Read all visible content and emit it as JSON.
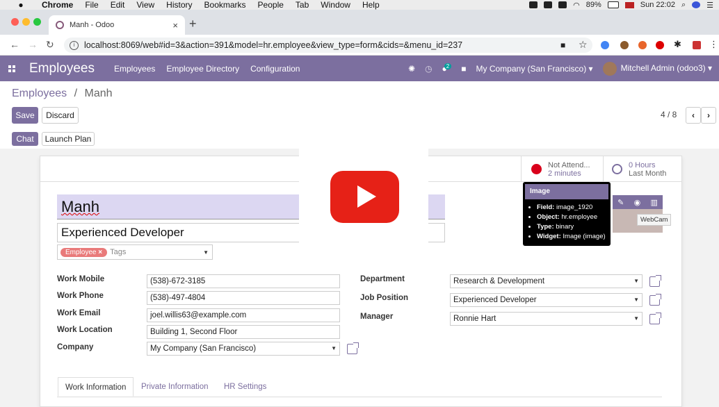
{
  "macbar": {
    "apple": "",
    "app": "Chrome",
    "menus": [
      "File",
      "Edit",
      "View",
      "History",
      "Bookmarks",
      "People",
      "Tab",
      "Window",
      "Help"
    ],
    "battery": "89%",
    "clock": "Sun 22:02"
  },
  "browser": {
    "tab_title": "Manh - Odoo",
    "url": "localhost:8069/web#id=3&action=391&model=hr.employee&view_type=form&cids=&menu_id=237"
  },
  "odoo_nav": {
    "brand": "Employees",
    "menus": [
      "Employees",
      "Employee Directory",
      "Configuration"
    ],
    "chat_badge": "2",
    "company": "My Company (San Francisco)",
    "user": "Mitchell Admin (odoo3)"
  },
  "control": {
    "breadcrumb_root": "Employees",
    "breadcrumb_sep": "/",
    "breadcrumb_current": "Manh",
    "save": "Save",
    "discard": "Discard",
    "pager": "4 / 8",
    "chat": "Chat",
    "launch_plan": "Launch Plan"
  },
  "stats": {
    "attendance_line1": "Not Attend...",
    "attendance_line2": "2 minutes",
    "hours_line1": "0 Hours",
    "hours_line2": "Last Month"
  },
  "employee": {
    "name": "Manh",
    "job_title": "Experienced Developer",
    "tag": "Employee",
    "tags_placeholder": "Tags"
  },
  "left_fields": [
    {
      "label": "Work Mobile",
      "value": "(538)-672-3185"
    },
    {
      "label": "Work Phone",
      "value": "(538)-497-4804"
    },
    {
      "label": "Work Email",
      "value": "joel.willis63@example.com"
    },
    {
      "label": "Work Location",
      "value": "Building 1, Second Floor"
    },
    {
      "label": "Company",
      "value": "My Company (San Francisco)"
    }
  ],
  "right_fields": [
    {
      "label": "Department",
      "value": "Research & Development"
    },
    {
      "label": "Job Position",
      "value": "Experienced Developer"
    },
    {
      "label": "Manager",
      "value": "Ronnie Hart"
    }
  ],
  "tooltip": {
    "title": "Image",
    "items": [
      {
        "k": "Field:",
        "v": "image_1920"
      },
      {
        "k": "Object:",
        "v": "hr.employee"
      },
      {
        "k": "Type:",
        "v": "binary"
      },
      {
        "k": "Widget:",
        "v": "Image (image)"
      }
    ]
  },
  "webcam_tip": "WebCam",
  "notebook_tabs": [
    "Work Information",
    "Private Information",
    "HR Settings"
  ],
  "colors": {
    "brand": "#7c6f9f",
    "youtube": "#e62117",
    "status_dot": "#d9001b"
  }
}
